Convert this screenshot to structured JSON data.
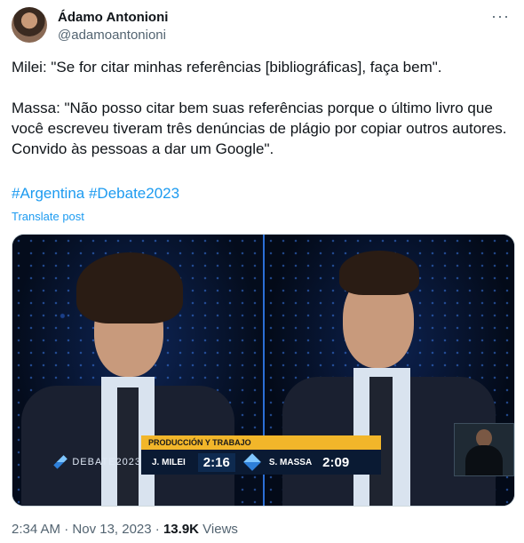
{
  "author": {
    "name": "Ádamo Antonioni",
    "handle": "@adamoantonioni"
  },
  "more_icon": "more-horizontal-icon",
  "body": {
    "line1": "Milei: \"Se for citar minhas referências [bibliográficas], faça bem\".",
    "line2": "Massa: \"Não posso citar bem suas referências porque o último livro que você escreveu tiveram três denúncias de plágio por copiar outros autores. Convido às pessoas a dar um Google\"."
  },
  "hashtags": [
    "#Argentina",
    "#Debate2023"
  ],
  "translate_label": "Translate post",
  "media": {
    "band_title": "PRODUCCIÓN Y TRABAJO",
    "logo_text": "DEBATE2023",
    "candidate1": "J. MILEI",
    "time1": "2:16",
    "candidate2": "S. MASSA",
    "time2": "2:09"
  },
  "meta": {
    "time": "2:34 AM",
    "date": "Nov 13, 2023",
    "views_count": "13.9K",
    "views_label": "Views"
  },
  "colors": {
    "link": "#1d9bf0",
    "text": "#0f1419",
    "muted": "#536471",
    "band": "#f2b62a"
  }
}
